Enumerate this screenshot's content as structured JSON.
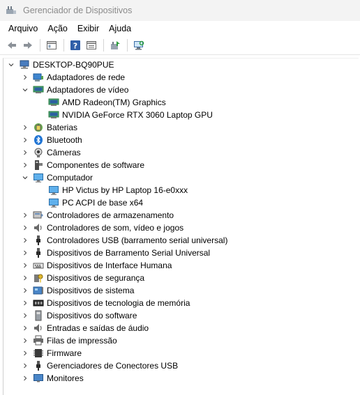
{
  "window": {
    "title": "Gerenciador de Dispositivos"
  },
  "menu": [
    "Arquivo",
    "Ação",
    "Exibir",
    "Ajuda"
  ],
  "toolbar": {
    "buttons": [
      "back-icon",
      "forward-icon",
      "properties-icon",
      "help-icon",
      "view-icon",
      "update-driver-icon",
      "scan-hardware-icon"
    ]
  },
  "tree": {
    "root": "DESKTOP-BQ90PUE",
    "items": [
      {
        "label": "Adaptadores de rede",
        "level": 1,
        "state": "collapsed",
        "icon": "network-adapter-icon"
      },
      {
        "label": "Adaptadores de vídeo",
        "level": 1,
        "state": "expanded",
        "icon": "display-adapter-icon"
      },
      {
        "label": "AMD Radeon(TM) Graphics",
        "level": 2,
        "state": "leaf",
        "icon": "display-adapter-icon"
      },
      {
        "label": "NVIDIA GeForce RTX 3060 Laptop GPU",
        "level": 2,
        "state": "leaf",
        "icon": "display-adapter-icon"
      },
      {
        "label": "Baterias",
        "level": 1,
        "state": "collapsed",
        "icon": "battery-icon"
      },
      {
        "label": "Bluetooth",
        "level": 1,
        "state": "collapsed",
        "icon": "bluetooth-icon"
      },
      {
        "label": "Câmeras",
        "level": 1,
        "state": "collapsed",
        "icon": "camera-icon"
      },
      {
        "label": "Componentes de software",
        "level": 1,
        "state": "collapsed",
        "icon": "software-component-icon"
      },
      {
        "label": "Computador",
        "level": 1,
        "state": "expanded",
        "icon": "computer-icon"
      },
      {
        "label": "HP Victus by HP Laptop 16-e0xxx",
        "level": 2,
        "state": "leaf",
        "icon": "computer-icon"
      },
      {
        "label": "PC ACPI de base x64",
        "level": 2,
        "state": "leaf",
        "icon": "computer-icon"
      },
      {
        "label": "Controladores de armazenamento",
        "level": 1,
        "state": "collapsed",
        "icon": "storage-controller-icon"
      },
      {
        "label": "Controladores de som, vídeo e jogos",
        "level": 1,
        "state": "collapsed",
        "icon": "speaker-icon"
      },
      {
        "label": "Controladores USB (barramento serial universal)",
        "level": 1,
        "state": "collapsed",
        "icon": "usb-icon"
      },
      {
        "label": "Dispositivos de Barramento Serial Universal",
        "level": 1,
        "state": "collapsed",
        "icon": "usb-icon"
      },
      {
        "label": "Dispositivos de Interface Humana",
        "level": 1,
        "state": "collapsed",
        "icon": "hid-icon"
      },
      {
        "label": "Dispositivos de segurança",
        "level": 1,
        "state": "collapsed",
        "icon": "security-key-icon"
      },
      {
        "label": "Dispositivos de sistema",
        "level": 1,
        "state": "collapsed",
        "icon": "system-device-icon"
      },
      {
        "label": "Dispositivos de tecnologia de memória",
        "level": 1,
        "state": "collapsed",
        "icon": "memory-icon"
      },
      {
        "label": "Dispositivos do software",
        "level": 1,
        "state": "collapsed",
        "icon": "software-device-icon"
      },
      {
        "label": "Entradas e saídas de áudio",
        "level": 1,
        "state": "collapsed",
        "icon": "speaker-icon"
      },
      {
        "label": "Filas de impressão",
        "level": 1,
        "state": "collapsed",
        "icon": "printer-icon"
      },
      {
        "label": "Firmware",
        "level": 1,
        "state": "collapsed",
        "icon": "firmware-icon"
      },
      {
        "label": "Gerenciadores de Conectores USB",
        "level": 1,
        "state": "collapsed",
        "icon": "usb-icon"
      },
      {
        "label": "Monitores",
        "level": 1,
        "state": "collapsed",
        "icon": "monitor-icon"
      }
    ]
  }
}
